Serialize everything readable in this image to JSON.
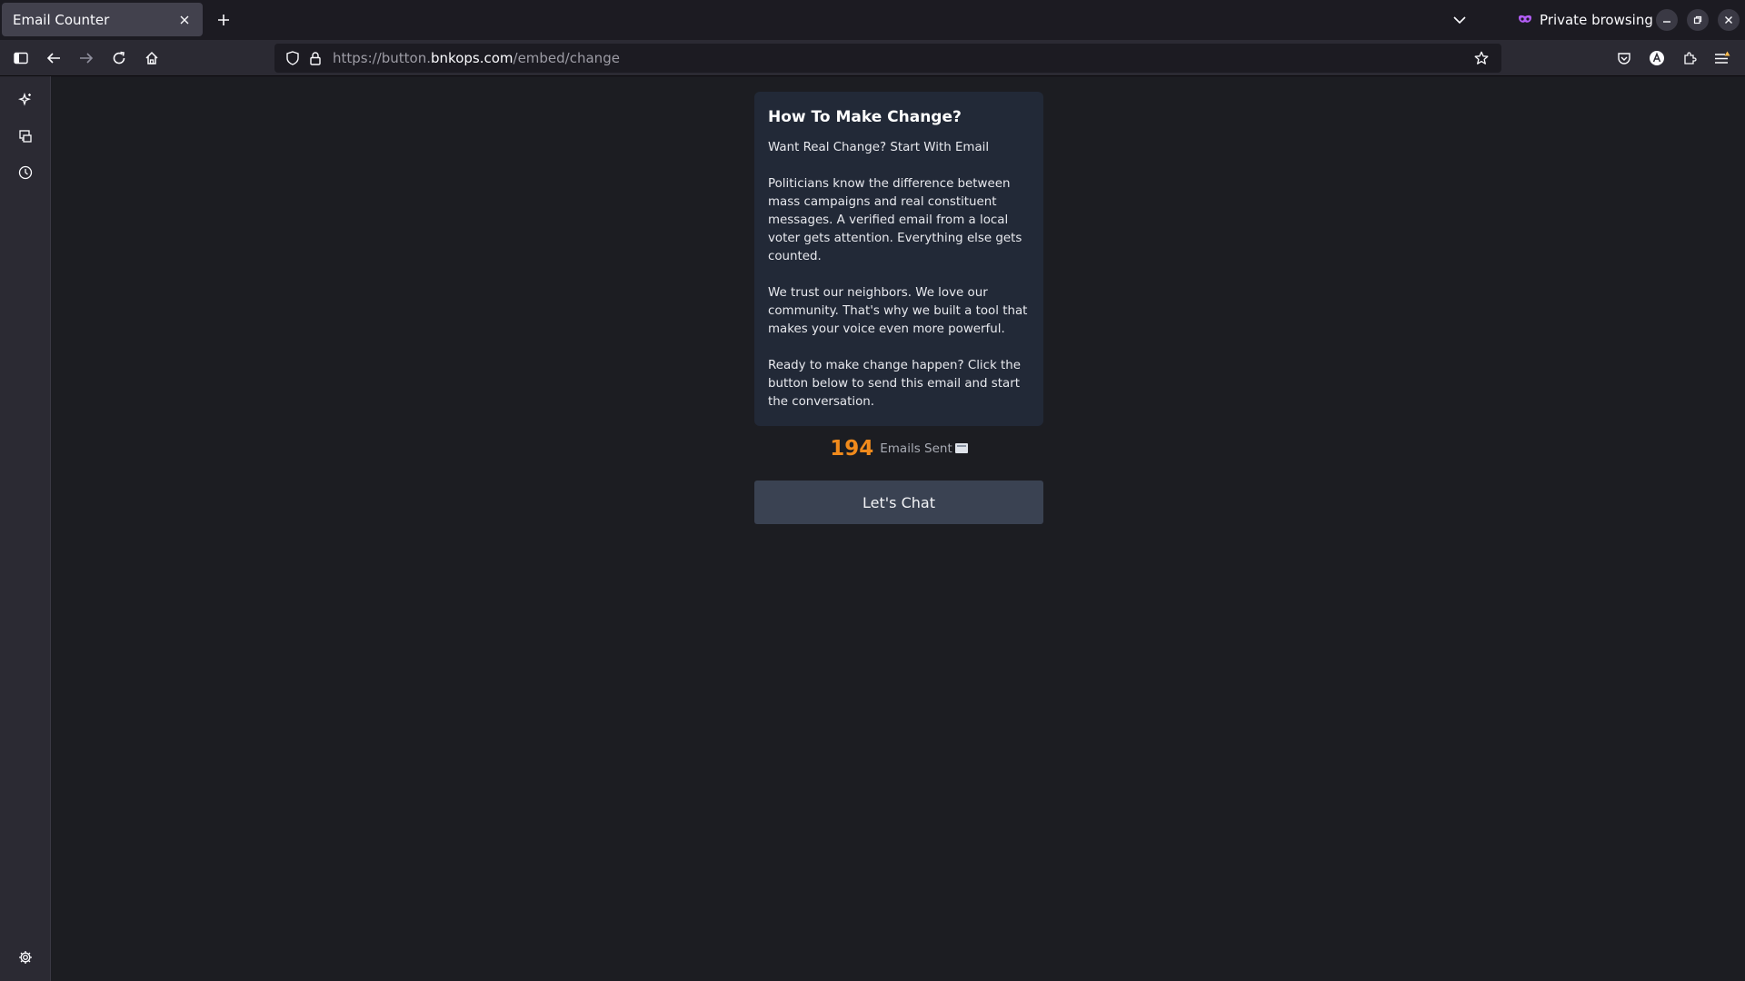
{
  "browser": {
    "tab_title": "Email Counter",
    "private_label": "Private browsing",
    "url": {
      "prefix": "https://button.",
      "domain": "bnkops.com",
      "path": "/embed/change"
    }
  },
  "content": {
    "heading": "How To Make Change?",
    "paragraphs": [
      "Want Real Change? Start With Email",
      "Politicians know the difference between mass campaigns and real constituent messages. A verified email from a local voter gets attention. Everything else gets counted.",
      "We trust our neighbors. We love our community. That's why we built a tool that makes your voice even more powerful.",
      "Ready to make change happen? Click the button below to send this email and start the conversation."
    ],
    "count": "194",
    "count_label": "Emails Sent",
    "button_label": "Let's Chat"
  },
  "colors": {
    "accent_count": "#f08a1c",
    "card_bg": "#222937",
    "button_bg": "#3a4252"
  }
}
